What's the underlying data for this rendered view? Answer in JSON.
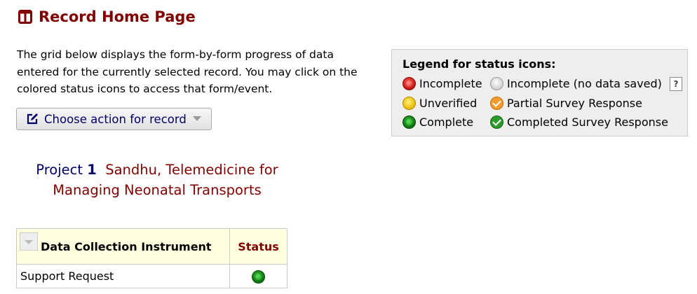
{
  "page": {
    "title": "Record Home Page",
    "title_icon": "columns-icon",
    "title_color": "#800000"
  },
  "intro": {
    "text": "The grid below displays the form-by-form progress of data entered for the currently selected record. You may click on the colored status icons to access that form/event."
  },
  "action_button": {
    "label": "Choose action for record",
    "icon": "edit-icon"
  },
  "legend": {
    "title": "Legend for status icons:",
    "items": {
      "incomplete": "Incomplete",
      "incomplete_no_data": "Incomplete (no data saved)",
      "unverified": "Unverified",
      "partial_survey": "Partial Survey Response",
      "complete": "Complete",
      "completed_survey": "Completed Survey Response"
    },
    "help_label": "?"
  },
  "project": {
    "label": "Project",
    "number": "1",
    "name": "Sandhu, Telemedicine for Managing Neonatal Transports"
  },
  "grid": {
    "headers": {
      "instrument": "Data Collection Instrument",
      "status": "Status"
    },
    "rows": [
      {
        "form": "Support Request",
        "status": "complete"
      }
    ]
  },
  "colors": {
    "title": "#800000",
    "link": "#000066",
    "header_bg": "#ffffe0",
    "legend_bg": "#eeeeee"
  }
}
